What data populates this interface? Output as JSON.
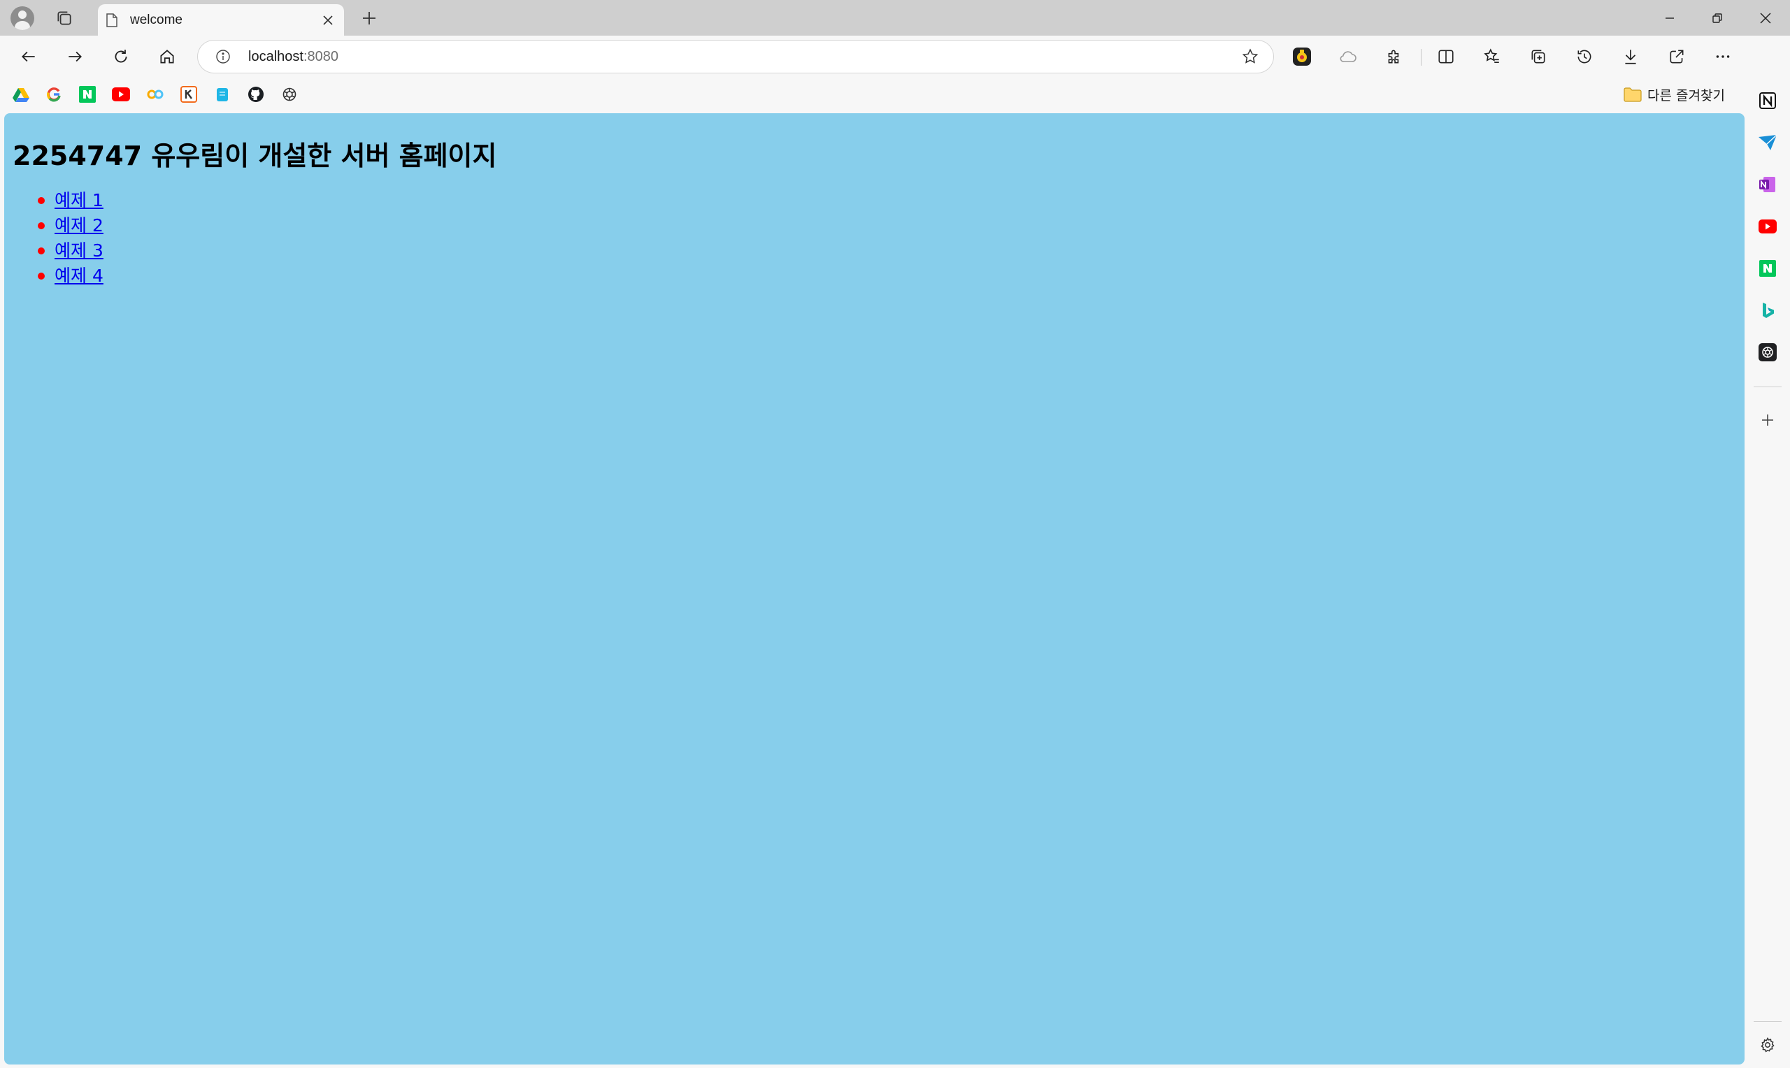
{
  "tab": {
    "title": "welcome"
  },
  "address_bar": {
    "host": "localhost",
    "port": ":8080"
  },
  "bookmarks": {
    "items": [
      "google-drive",
      "google",
      "naver",
      "youtube",
      "colab",
      "kakao",
      "bookmark-app",
      "github",
      "openai"
    ],
    "folder_label": "다른 즐겨찾기"
  },
  "sidebar": {
    "items": [
      "notion",
      "mail",
      "onenote",
      "youtube",
      "naver",
      "bing",
      "chatgpt"
    ]
  },
  "page": {
    "heading": "2254747 유우림이 개설한 서버 홈페이지",
    "links": [
      {
        "label": "예제 1"
      },
      {
        "label": "예제 2"
      },
      {
        "label": "예제 3"
      },
      {
        "label": "예제 4"
      }
    ]
  },
  "colors": {
    "page_background": "#87ceeb",
    "bullet": "#ff0000",
    "link": "#0000ee",
    "tabstrip": "#cfcfcf"
  }
}
